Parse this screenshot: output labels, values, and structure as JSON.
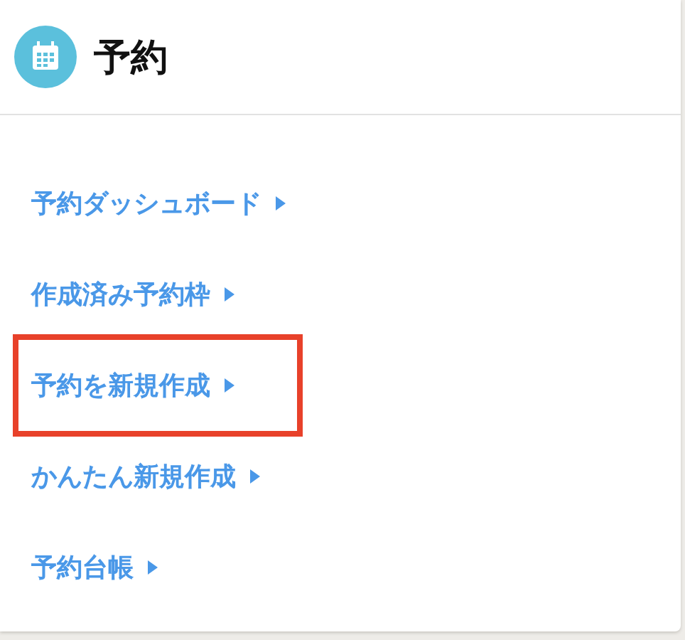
{
  "header": {
    "title": "予約"
  },
  "menu": [
    {
      "label": "予約ダッシュボード",
      "highlighted": false
    },
    {
      "label": "作成済み予約枠",
      "highlighted": false
    },
    {
      "label": "予約を新規作成",
      "highlighted": true
    },
    {
      "label": "かんたん新規作成",
      "highlighted": false
    },
    {
      "label": "予約台帳",
      "highlighted": false
    }
  ]
}
